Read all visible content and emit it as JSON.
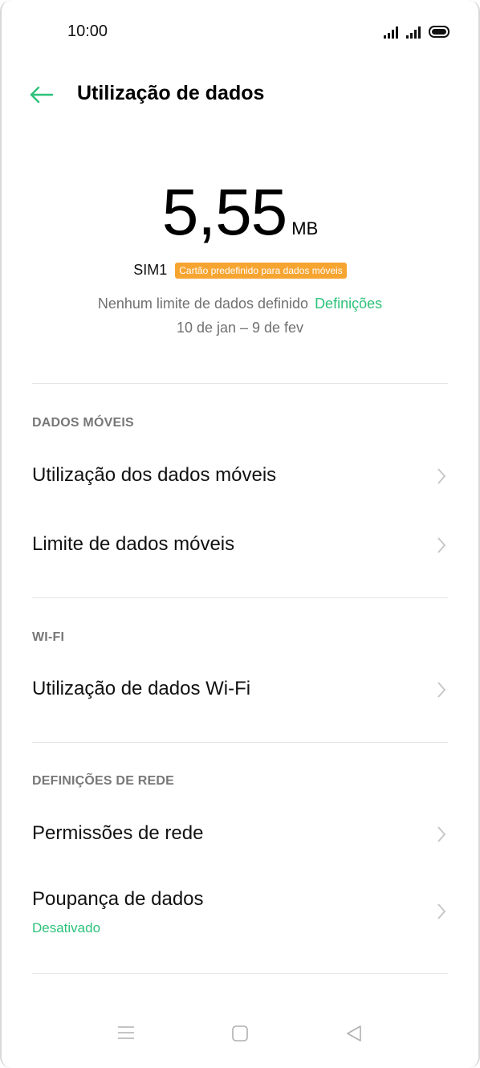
{
  "status_bar": {
    "time": "10:00"
  },
  "header": {
    "title": "Utilização de dados",
    "back_icon": "arrow-left-icon"
  },
  "usage": {
    "amount": "5,55",
    "unit": "MB",
    "sim_label": "SIM1",
    "sim_badge": "Cartão predefinido para dados móveis",
    "limit_text": "Nenhum limite de dados definido",
    "limit_link": "Definições",
    "period": "10 de jan – 9 de fev"
  },
  "sections": {
    "mobile": {
      "title": "DADOS MÓVEIS",
      "items": [
        {
          "label": "Utilização dos dados móveis"
        },
        {
          "label": "Limite de dados móveis"
        }
      ]
    },
    "wifi": {
      "title": "WI-FI",
      "items": [
        {
          "label": "Utilização de dados Wi-Fi"
        }
      ]
    },
    "network": {
      "title": "DEFINIÇÕES DE REDE",
      "items": [
        {
          "label": "Permissões de rede"
        },
        {
          "label": "Poupança de dados",
          "sublabel": "Desativado"
        }
      ]
    }
  },
  "colors": {
    "accent": "#2dc27a",
    "badge": "#f7a531",
    "secondary_text": "#707070"
  }
}
